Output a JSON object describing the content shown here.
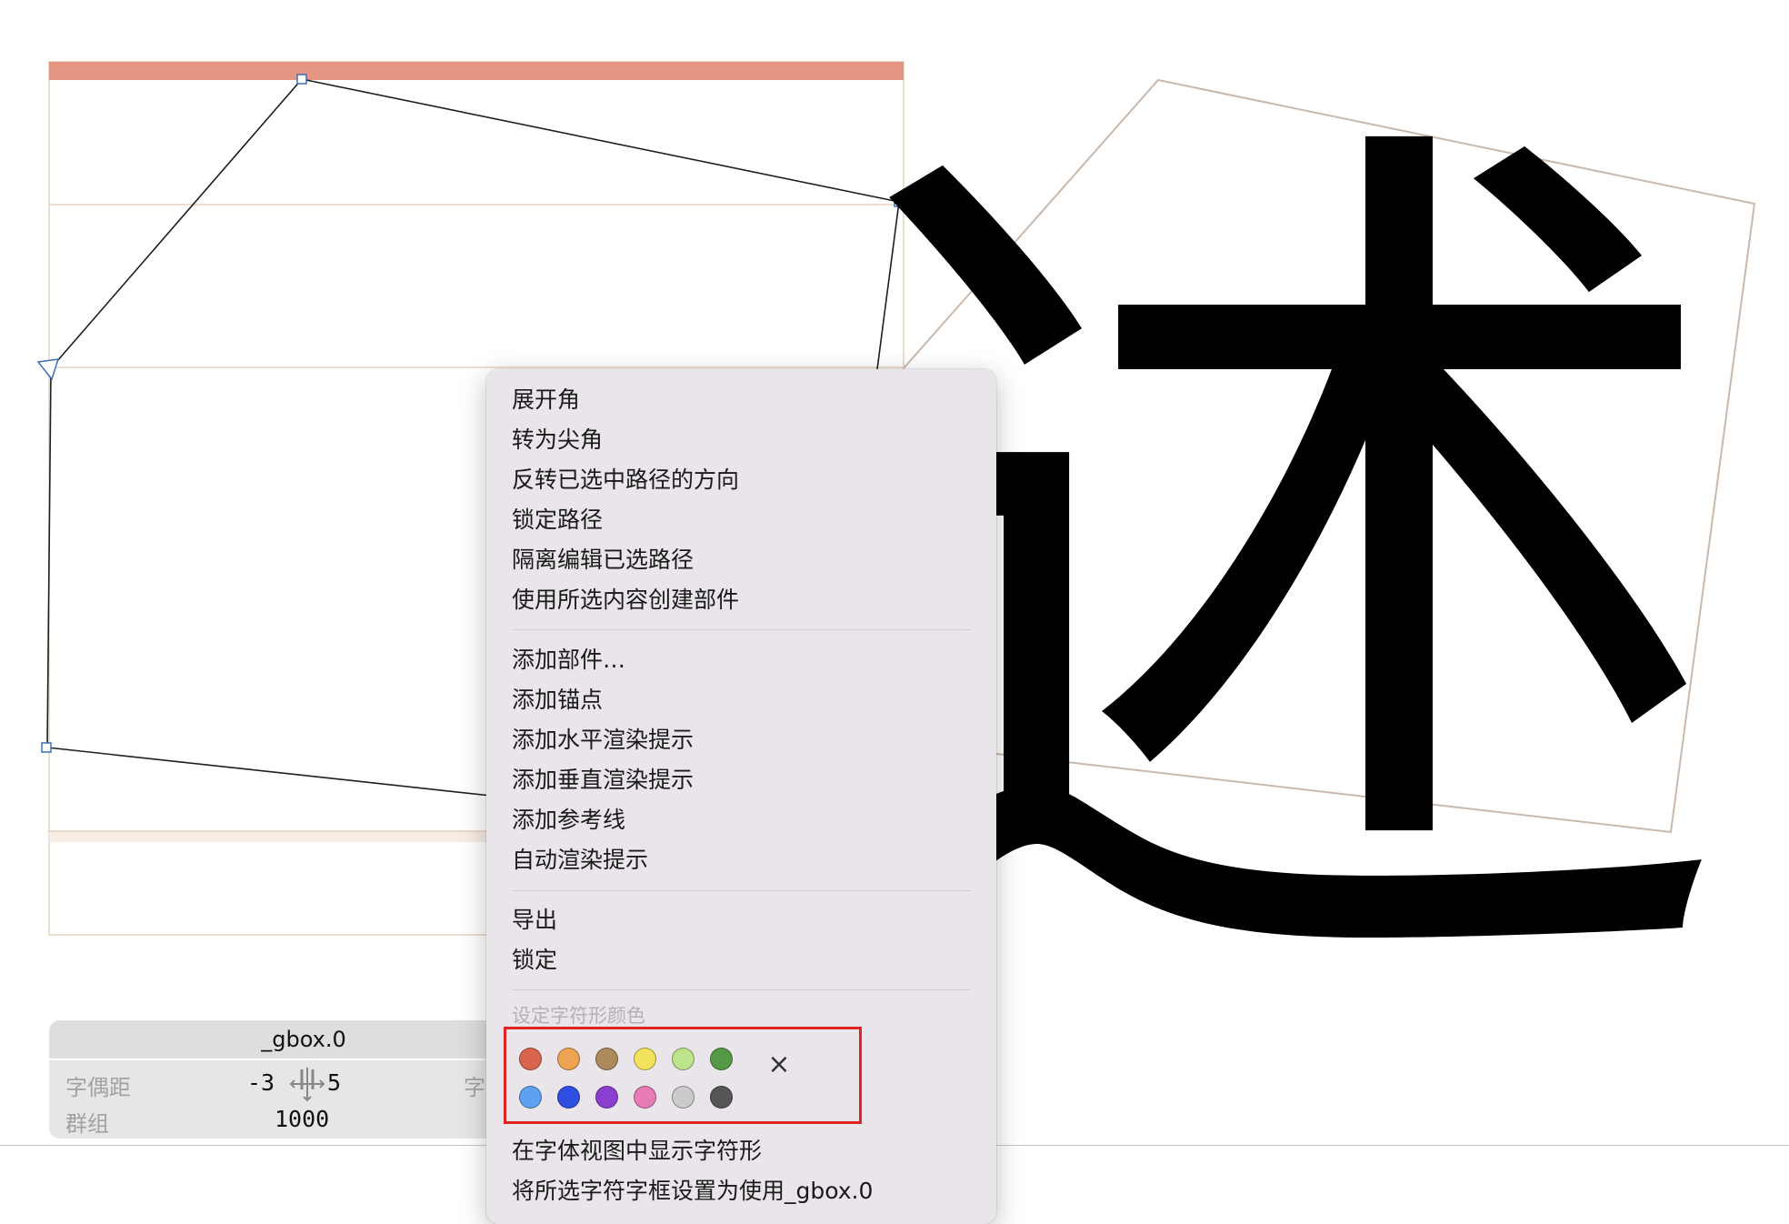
{
  "canvas": {
    "glyph_char": "述",
    "colors": {
      "top_bar": "#e59683",
      "metric_lines": "#e3d3c2",
      "baseline_band": "#f7ece4",
      "outline": "#1f1f1f",
      "node": "#3b6fb6",
      "preview_frame": "#c9b9ad",
      "glyph": "#000000"
    }
  },
  "info_panel": {
    "title": "_gbox.0",
    "kerning_label": "字偶距",
    "kerning_left": "-3",
    "kerning_right": "5",
    "group_label": "群组",
    "group_value": "1000",
    "obscured_label": "字"
  },
  "context_menu": {
    "group1": [
      "展开角",
      "转为尖角",
      "反转已选中路径的方向",
      "锁定路径",
      "隔离编辑已选路径",
      "使用所选内容创建部件"
    ],
    "group2": [
      "添加部件…",
      "添加锚点",
      "添加水平渲染提示",
      "添加垂直渲染提示",
      "添加参考线",
      "自动渲染提示"
    ],
    "group3": [
      "导出",
      "锁定"
    ],
    "color_section_label": "设定字符形颜色",
    "color_swatches_row1": [
      {
        "name": "red",
        "color": "#d9664c"
      },
      {
        "name": "orange",
        "color": "#eda352"
      },
      {
        "name": "brown",
        "color": "#ad8a5c"
      },
      {
        "name": "yellow",
        "color": "#f2e25c"
      },
      {
        "name": "light-green",
        "color": "#bde38c"
      },
      {
        "name": "dark-green",
        "color": "#549a46"
      }
    ],
    "color_swatches_row2": [
      {
        "name": "light-blue",
        "color": "#5ea1f0"
      },
      {
        "name": "dark-blue",
        "color": "#2f4fe0"
      },
      {
        "name": "purple",
        "color": "#8a3fd0"
      },
      {
        "name": "pink",
        "color": "#e67bb8"
      },
      {
        "name": "light-gray",
        "color": "#cbcbcb"
      },
      {
        "name": "dark-gray",
        "color": "#555555"
      }
    ],
    "clear_color_icon": "x-icon",
    "group4": [
      "在字体视图中显示字符形",
      "将所选字符字框设置为使用_gbox.0"
    ]
  }
}
